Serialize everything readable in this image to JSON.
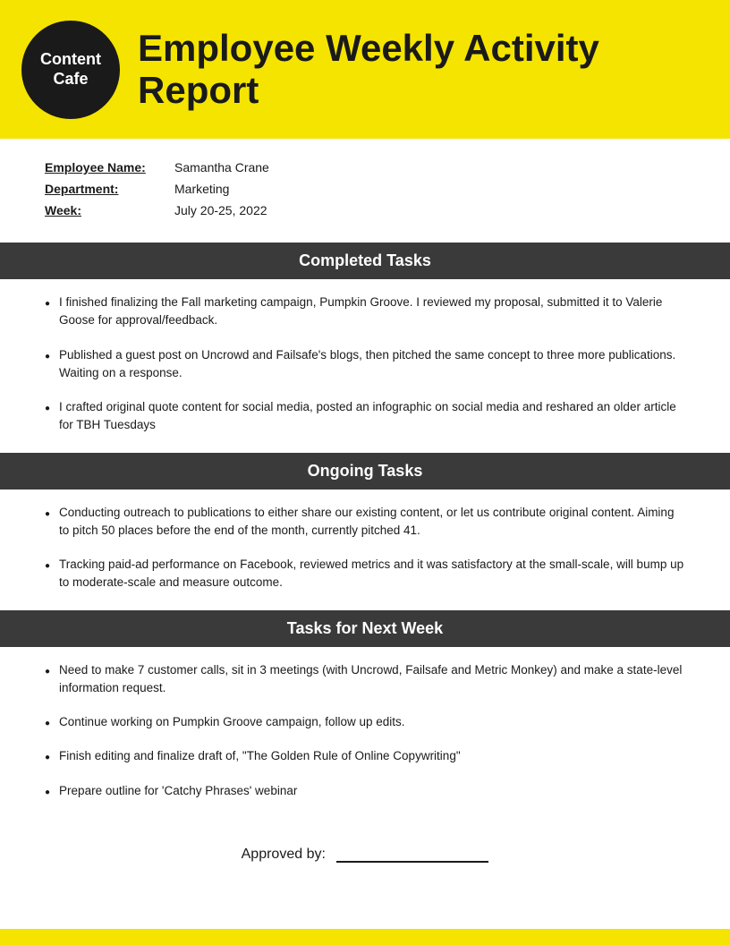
{
  "header": {
    "logo_line1": "Content",
    "logo_line2": "Cafe",
    "title": "Employee Weekly Activity Report"
  },
  "info": {
    "employee_label": "Employee Name:",
    "employee_value": "Samantha Crane",
    "department_label": "Department:",
    "department_value": "Marketing",
    "week_label": "Week:",
    "week_value": "July 20-25, 2022"
  },
  "completed_tasks": {
    "heading": "Completed Tasks",
    "items": [
      "I finished finalizing the Fall marketing campaign, Pumpkin Groove. I reviewed my proposal, submitted it to Valerie Goose for approval/feedback.",
      "Published a guest post on Uncrowd and Failsafe's blogs, then pitched the same concept to three more publications. Waiting on a response.",
      "I crafted original quote content for social media, posted an infographic on social media and reshared an older article for TBH Tuesdays"
    ]
  },
  "ongoing_tasks": {
    "heading": "Ongoing Tasks",
    "items": [
      "Conducting outreach to publications to either share our existing content, or let us contribute original content. Aiming to pitch 50 places before the end of the month, currently pitched 41.",
      "Tracking paid-ad performance on Facebook, reviewed metrics and it was satisfactory at the small-scale, will bump up to moderate-scale and measure outcome."
    ]
  },
  "next_week_tasks": {
    "heading": "Tasks for Next Week",
    "items": [
      "Need to make 7 customer calls, sit in 3 meetings (with Uncrowd, Failsafe and Metric Monkey) and make a state-level information request.",
      "Continue working on Pumpkin Groove campaign, follow up edits.",
      "Finish editing and finalize draft of, \"The Golden Rule of Online Copywriting\"",
      "Prepare outline for 'Catchy Phrases' webinar"
    ]
  },
  "approved": {
    "label": "Approved by:"
  }
}
